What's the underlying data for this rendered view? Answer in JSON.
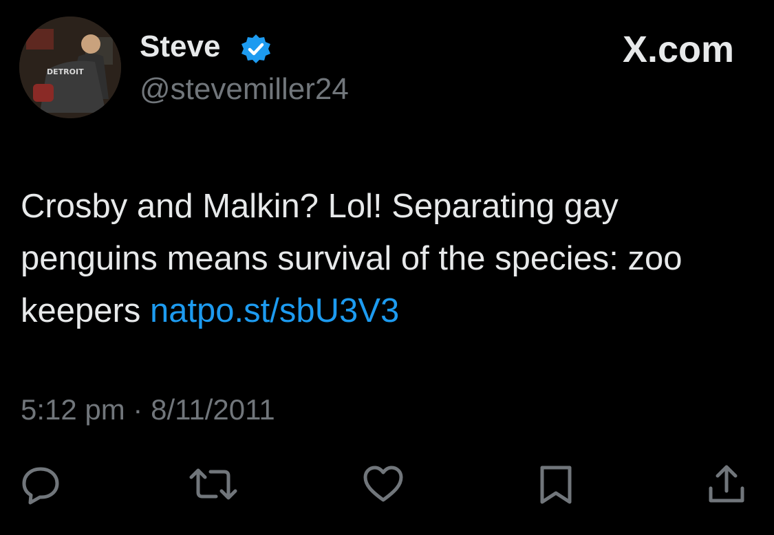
{
  "author": {
    "display_name": "Steve",
    "handle": "@stevemiller24",
    "verified": true,
    "avatar_shirt_text": "DETROIT"
  },
  "brand": "X.com",
  "tweet": {
    "text": "Crosby and Malkin? Lol!  Separating gay penguins means survival of the species: zoo keepers ",
    "link_text": "natpo.st/sbU3V3"
  },
  "meta": {
    "time": "5:12 pm",
    "separator": " · ",
    "date": "8/11/2011"
  },
  "actions": [
    "reply-icon",
    "retweet-icon",
    "like-icon",
    "bookmark-icon",
    "share-icon"
  ],
  "colors": {
    "background": "#000000",
    "text": "#e7e9ea",
    "secondary": "#71767b",
    "link": "#1d9bf0",
    "verified": "#1d9bf0"
  }
}
